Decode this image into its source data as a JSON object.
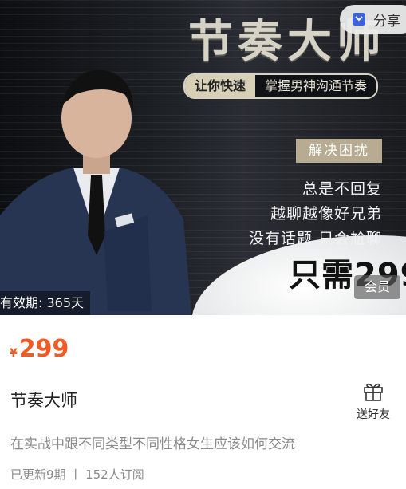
{
  "share": {
    "label": "分享"
  },
  "banner": {
    "title": "节奏大师",
    "pill_left": "让你快速",
    "pill_right": "掌握男神沟通节奏",
    "tag": "解决困扰",
    "lines": [
      "总是不回复",
      "越聊越像好兄弟",
      "没有话题  只会尬聊"
    ],
    "only_price": "只需299",
    "member_label": "会员",
    "validity": "有效期: 365天"
  },
  "product": {
    "currency": "¥",
    "price": "299",
    "title": "节奏大师",
    "gift_label": "送好友",
    "description": "在实战中跟不同类型不同性格女生应该如何交流",
    "meta": "已更新9期 丨 152人订阅"
  },
  "colors": {
    "price": "#f05a24",
    "tag": "#b7ab92"
  }
}
